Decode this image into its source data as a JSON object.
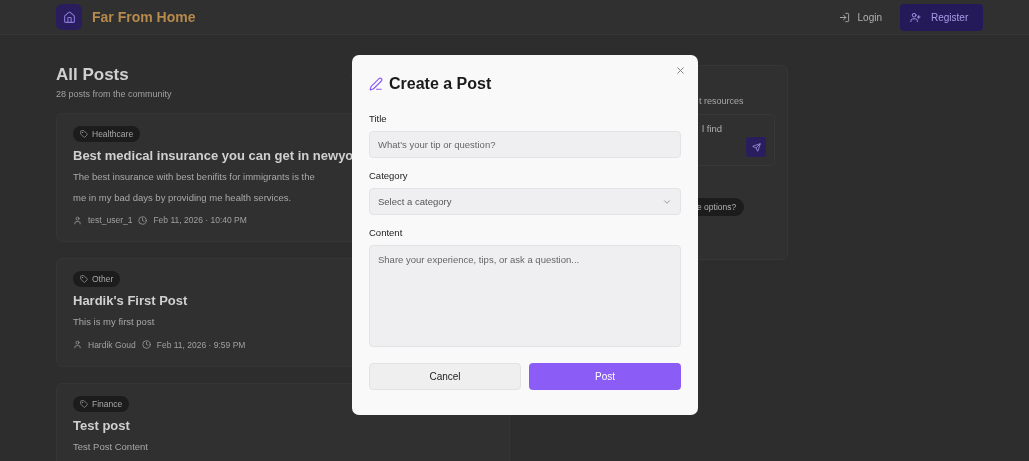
{
  "header": {
    "brand": "Far From Home",
    "login": "Login",
    "register": "Register"
  },
  "posts_header": {
    "title": "All Posts",
    "subtitle": "28 posts from the community"
  },
  "posts": [
    {
      "category": "Healthcare",
      "title": "Best medical insurance you can get in newyo",
      "body_lines": [
        "The best insurance with best benifits for immigrants is the",
        "me in my bad days by providing me health services."
      ],
      "author": "test_user_1",
      "date": "Feb 11, 2026 · 10:40 PM"
    },
    {
      "category": "Other",
      "title": "Hardik's First Post",
      "body_lines": [
        "This is my first post"
      ],
      "author": "Hardik Goud",
      "date": "Feb 11, 2026 · 9:59 PM"
    },
    {
      "category": "Finance",
      "title": "Test post",
      "body_lines": [
        "Test Post Content"
      ]
    }
  ],
  "sidebar": {
    "text_1": "t resources",
    "text_2": "l find",
    "button": "e options?"
  },
  "modal": {
    "title": "Create a Post",
    "fields": [
      {
        "kind": "input",
        "label": "Title",
        "placeholder": "What's your tip or question?"
      },
      {
        "kind": "select",
        "label": "Category",
        "placeholder": "Select a category"
      },
      {
        "kind": "textarea",
        "label": "Content",
        "placeholder": "Share your experience, tips, or ask a question..."
      }
    ],
    "cancel": "Cancel",
    "submit": "Post"
  }
}
